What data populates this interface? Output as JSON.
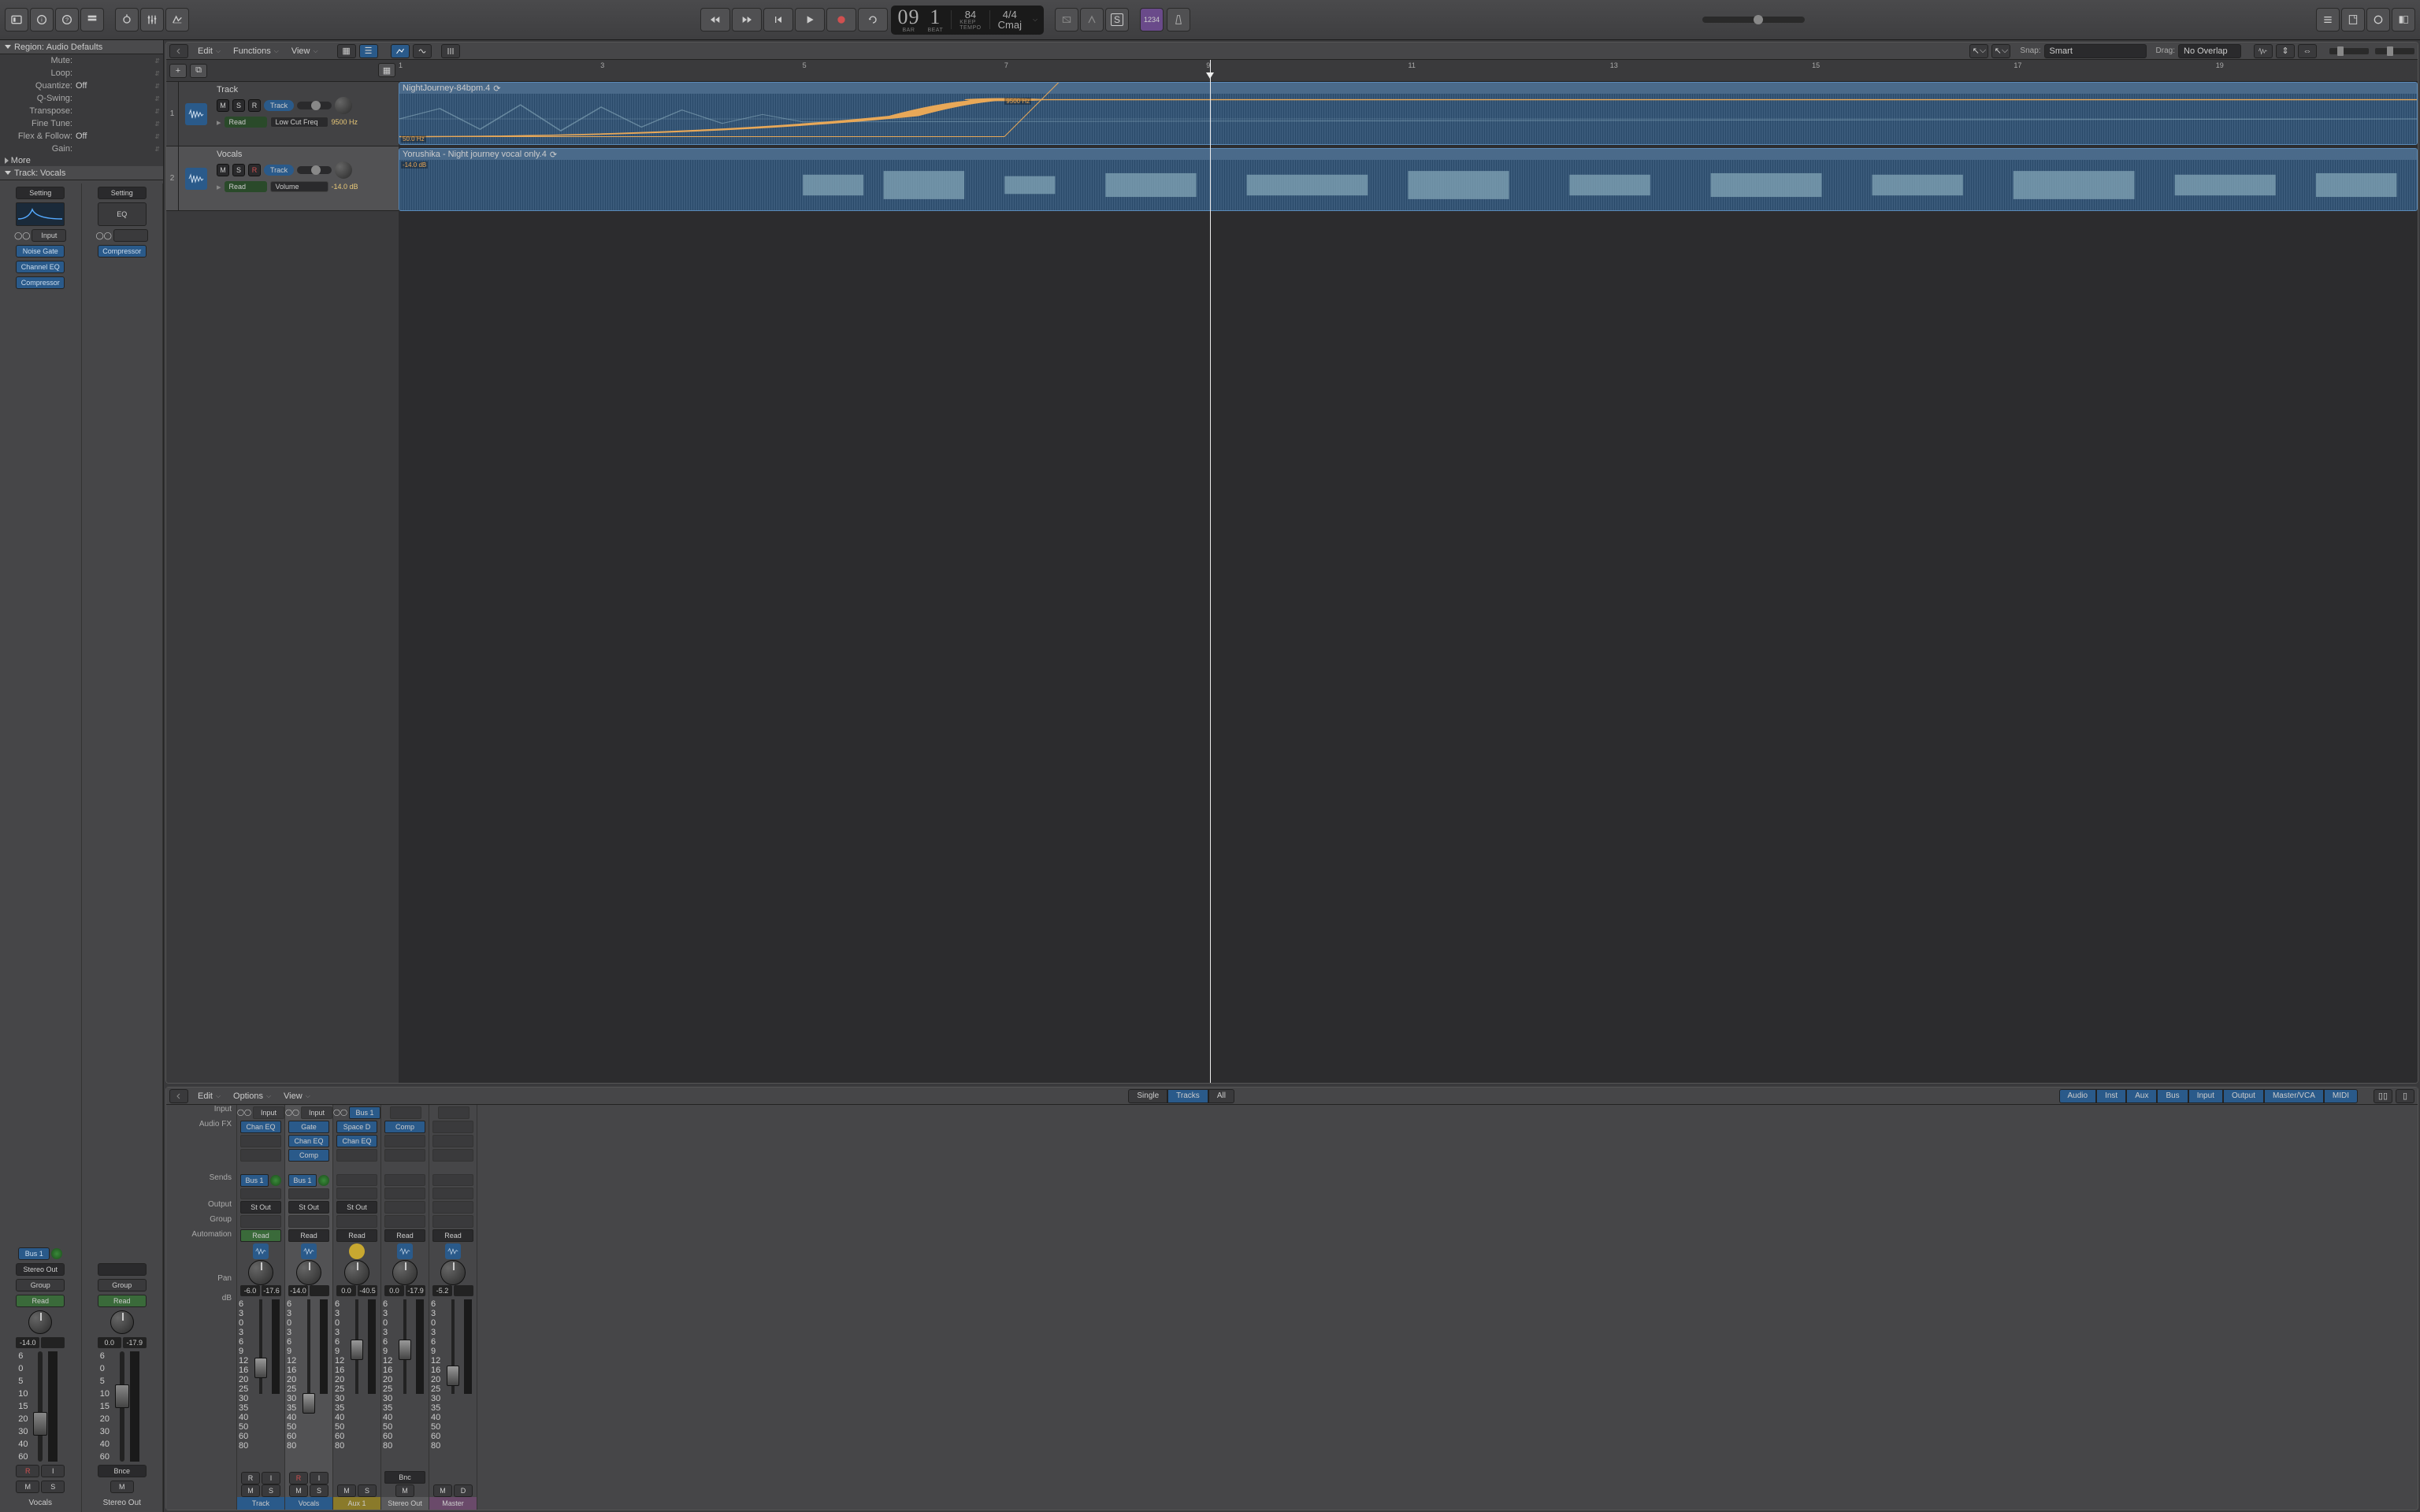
{
  "toolbar": {
    "lcd": {
      "bars": "09",
      "beats": "1",
      "tempo": "84",
      "tempo_label": "KEEP\nTEMPO",
      "sig": "4/4",
      "key": "Cmaj",
      "bar_label": "BAR",
      "beat_label": "BEAT"
    },
    "numbers_btn": "1234"
  },
  "inspector": {
    "region_header": "Region:",
    "region_name": "Audio Defaults",
    "rows": [
      {
        "label": "Mute:",
        "val": ""
      },
      {
        "label": "Loop:",
        "val": ""
      },
      {
        "label": "Quantize:",
        "val": "Off"
      },
      {
        "label": "Q-Swing:",
        "val": ""
      },
      {
        "label": "Transpose:",
        "val": ""
      },
      {
        "label": "Fine Tune:",
        "val": ""
      },
      {
        "label": "Flex & Follow:",
        "val": "Off"
      },
      {
        "label": "Gain:",
        "val": ""
      }
    ],
    "more": "More",
    "track_header": "Track:",
    "track_name": "Vocals",
    "strips": [
      {
        "setting": "Setting",
        "input": "Input",
        "fx": [
          "Noise Gate",
          "Channel EQ",
          "Compressor"
        ],
        "sends": [
          "Bus 1"
        ],
        "output": "Stereo Out",
        "group": "Group",
        "auto": "Read",
        "db1": "-14.0",
        "db2": "",
        "ri": [
          "R",
          "I"
        ],
        "ms": [
          "M",
          "S"
        ],
        "name": "Vocals"
      },
      {
        "setting": "Setting",
        "eq": "EQ",
        "input": "",
        "fx": [
          "Compressor"
        ],
        "sends": [],
        "output": "",
        "group": "Group",
        "auto": "Read",
        "db1": "0.0",
        "db2": "-17.9",
        "bnce": "Bnce",
        "ms": [
          "M"
        ],
        "name": "Stereo Out"
      }
    ]
  },
  "tracks_toolbar": {
    "menus": [
      "Edit",
      "Functions",
      "View"
    ],
    "snap_label": "Snap:",
    "snap_val": "Smart",
    "drag_label": "Drag:",
    "drag_val": "No Overlap"
  },
  "ruler": {
    "marks": [
      1,
      3,
      5,
      7,
      9,
      11,
      13,
      15,
      17,
      19
    ]
  },
  "tracks": [
    {
      "num": "1",
      "name": "Track",
      "msr": [
        "M",
        "S",
        "R"
      ],
      "type": "Track",
      "auto_mode": "Read",
      "auto_param": "Low Cut Freq",
      "auto_val": "9500 Hz",
      "region_name": "NightJourney-84bpm.4",
      "auto_labels": [
        "9500 Hz",
        "50.0 Hz"
      ]
    },
    {
      "num": "2",
      "name": "Vocals",
      "msr": [
        "M",
        "S",
        "R"
      ],
      "type": "Track",
      "auto_mode": "Read",
      "auto_param": "Volume",
      "auto_val": "-14.0 dB",
      "region_name": "Yorushika - Night journey vocal only.4",
      "auto_labels": [
        "-14.0 dB"
      ],
      "rec": true
    }
  ],
  "mixer_toolbar": {
    "menus": [
      "Edit",
      "Options",
      "View"
    ],
    "view_tabs": [
      "Single",
      "Tracks",
      "All"
    ],
    "type_tabs": [
      "Audio",
      "Inst",
      "Aux",
      "Bus",
      "Input",
      "Output",
      "Master/VCA",
      "MIDI"
    ]
  },
  "mixer_labels": [
    "Input",
    "Audio FX",
    "",
    "Sends",
    "Output",
    "Group",
    "Automation",
    "",
    "Pan",
    "dB"
  ],
  "mixer_strips": [
    {
      "input": "Input",
      "fx": [
        "Chan EQ"
      ],
      "sends": [
        "Bus 1"
      ],
      "output": "St Out",
      "auto": "Read",
      "db": [
        "-6.0",
        "-17.6"
      ],
      "ri": [
        "R",
        "I"
      ],
      "ms": [
        "M",
        "S"
      ],
      "name": "Track",
      "color": "blue"
    },
    {
      "input": "Input",
      "fx": [
        "Gate",
        "Chan EQ",
        "Comp"
      ],
      "sends": [
        "Bus 1"
      ],
      "output": "St Out",
      "auto": "Read",
      "db": [
        "-14.0",
        ""
      ],
      "ri": [
        "R",
        "I"
      ],
      "ms": [
        "M",
        "S"
      ],
      "name": "Vocals",
      "color": "blue",
      "sel": true
    },
    {
      "input": "Bus 1",
      "fx": [
        "Space D",
        "Chan EQ"
      ],
      "sends": [],
      "output": "St Out",
      "auto": "Read",
      "db": [
        "0.0",
        "-40.5"
      ],
      "ms": [
        "M",
        "S"
      ],
      "name": "Aux 1",
      "color": "yellow"
    },
    {
      "input": "",
      "fx": [
        "Comp"
      ],
      "sends": [],
      "output": "",
      "auto": "Read",
      "db": [
        "0.0",
        "-17.9"
      ],
      "bnc": "Bnc",
      "ms": [
        "M"
      ],
      "name": "Stereo Out",
      "color": "gray"
    },
    {
      "input": "",
      "fx": [],
      "sends": [],
      "output": "",
      "auto": "Read",
      "db": [
        "-5.2",
        ""
      ],
      "ms": [
        "M",
        "D"
      ],
      "name": "Master",
      "color": "purple"
    }
  ]
}
